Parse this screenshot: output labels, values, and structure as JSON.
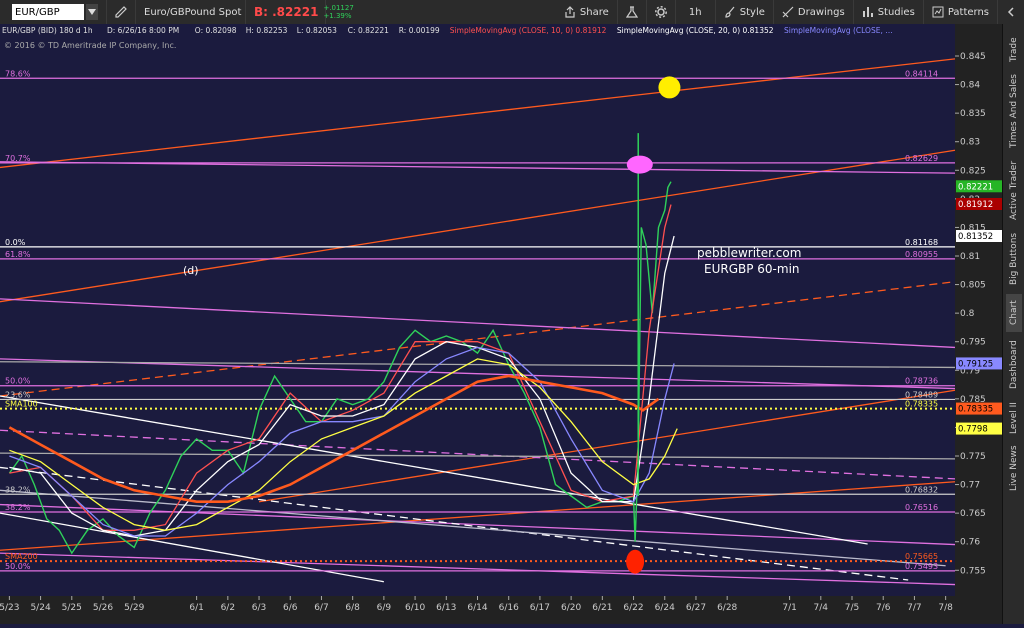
{
  "toolbar": {
    "symbol": "EUR/GBP",
    "pencil_icon": "pencil-icon",
    "description": "Euro/GBPound Spot",
    "bid_label": "B: .82221",
    "change_abs": "+.01127",
    "change_pct": "+1.39%",
    "share_label": "Share",
    "interval_label": "1h",
    "style_label": "Style",
    "drawings_label": "Drawings",
    "studies_label": "Studies",
    "patterns_label": "Patterns"
  },
  "chart_header": {
    "ohlc": [
      "EUR/GBP (BID) 180 d 1h",
      "D: 6/26/16 8:00 PM",
      "O: 0.82098",
      "H: 0.82253",
      "L: 0.82053",
      "C: 0.82221",
      "R: 0.00199"
    ],
    "studies": [
      {
        "text": "SimpleMovingAvg (CLOSE, 10, 0)",
        "value": "0.81912",
        "color": "#ff5050"
      },
      {
        "text": "SimpleMovingAvg (CLOSE, 20, 0)",
        "value": "0.81352",
        "color": "#ffffff"
      },
      {
        "text": "SimpleMovingAvg (CLOSE, …",
        "value": "",
        "color": "#8888ff"
      }
    ],
    "copyright": "© 2016 © TD Ameritrade IP Company, Inc."
  },
  "annotations": {
    "letter": "(d)",
    "site": "pebblewriter.com",
    "subtitle": "EURGBP 60-min"
  },
  "sidebar": [
    "Trade",
    "Times And Sales",
    "Active Trader",
    "Big Buttons",
    "Chart",
    "Dashboard",
    "Level II",
    "Live News"
  ],
  "chart_data": {
    "type": "line",
    "title": "EURGBP 60-min",
    "ylim": [
      0.7505,
      0.8485
    ],
    "yticks": [
      0.755,
      0.76,
      0.765,
      0.77,
      0.775,
      0.78,
      0.785,
      0.79,
      0.795,
      0.8,
      0.805,
      0.81,
      0.815,
      0.82,
      0.825,
      0.83,
      0.835,
      0.84,
      0.845
    ],
    "ytick_labels": [
      "0.755",
      "0.76",
      "0.765",
      "0.77",
      "0.775",
      "0.78",
      "0.785",
      "0.79",
      "0.795",
      "0.8",
      "0.805",
      "0.81",
      "0.815",
      "0.82",
      "0.825",
      "0.83",
      "0.835",
      "0.84",
      "0.845"
    ],
    "xticks": [
      {
        "label": "5/23",
        "x": 0
      },
      {
        "label": "5/24",
        "x": 1
      },
      {
        "label": "5/25",
        "x": 2
      },
      {
        "label": "5/26",
        "x": 3
      },
      {
        "label": "5/29",
        "x": 4
      },
      {
        "label": "6/1",
        "x": 6
      },
      {
        "label": "6/2",
        "x": 7
      },
      {
        "label": "6/3",
        "x": 8
      },
      {
        "label": "6/6",
        "x": 9
      },
      {
        "label": "6/7",
        "x": 10
      },
      {
        "label": "6/8",
        "x": 11
      },
      {
        "label": "6/9",
        "x": 12
      },
      {
        "label": "6/10",
        "x": 13
      },
      {
        "label": "6/13",
        "x": 14
      },
      {
        "label": "6/14",
        "x": 15
      },
      {
        "label": "6/16",
        "x": 16
      },
      {
        "label": "6/17",
        "x": 17
      },
      {
        "label": "6/20",
        "x": 18
      },
      {
        "label": "6/21",
        "x": 19
      },
      {
        "label": "6/22",
        "x": 20
      },
      {
        "label": "6/24",
        "x": 21
      },
      {
        "label": "6/27",
        "x": 22
      },
      {
        "label": "6/28",
        "x": 23
      },
      {
        "label": "7/1",
        "x": 25
      },
      {
        "label": "7/4",
        "x": 26
      },
      {
        "label": "7/5",
        "x": 27
      },
      {
        "label": "7/6",
        "x": 28
      },
      {
        "label": "7/7",
        "x": 29
      },
      {
        "label": "7/8",
        "x": 30
      }
    ],
    "xlim": [
      -0.3,
      30.3
    ],
    "series": [
      {
        "name": "Price",
        "color": "#2fd15a",
        "x": [
          0,
          0.4,
          0.8,
          1.2,
          1.6,
          2,
          2.5,
          3,
          3.5,
          4,
          4.5,
          5,
          5.5,
          6,
          6.5,
          7,
          7.5,
          8,
          8.5,
          9,
          9.5,
          10,
          10.5,
          11,
          11.5,
          12,
          12.5,
          13,
          13.5,
          14,
          14.5,
          15,
          15.5,
          16,
          16.5,
          17,
          17.5,
          18,
          18.5,
          19,
          19.5,
          20,
          20.05,
          20.15,
          20.25,
          20.4,
          20.6,
          20.8,
          21,
          21.1,
          21.2
        ],
        "values": [
          0.772,
          0.775,
          0.77,
          0.764,
          0.762,
          0.758,
          0.762,
          0.764,
          0.761,
          0.759,
          0.765,
          0.769,
          0.775,
          0.778,
          0.776,
          0.776,
          0.772,
          0.783,
          0.789,
          0.785,
          0.781,
          0.781,
          0.785,
          0.784,
          0.785,
          0.788,
          0.794,
          0.797,
          0.795,
          0.796,
          0.795,
          0.793,
          0.797,
          0.791,
          0.786,
          0.78,
          0.77,
          0.768,
          0.766,
          0.767,
          0.767,
          0.768,
          0.76,
          0.775,
          0.815,
          0.812,
          0.8,
          0.815,
          0.818,
          0.822,
          0.823
        ]
      },
      {
        "name": "SMA10",
        "color": "#ff5050",
        "x": [
          0,
          1,
          2,
          3,
          4,
          5,
          6,
          7,
          8,
          9,
          10,
          11,
          12,
          13,
          14,
          15,
          16,
          17,
          18,
          19,
          20,
          20.5,
          21,
          21.2
        ],
        "values": [
          0.772,
          0.773,
          0.768,
          0.762,
          0.762,
          0.763,
          0.772,
          0.776,
          0.778,
          0.786,
          0.781,
          0.783,
          0.786,
          0.795,
          0.795,
          0.795,
          0.793,
          0.781,
          0.769,
          0.767,
          0.768,
          0.797,
          0.815,
          0.819
        ]
      },
      {
        "name": "SMA20",
        "color": "#ffffff",
        "x": [
          0,
          1,
          2,
          3,
          4,
          5,
          6,
          7,
          8,
          9,
          10,
          11,
          12,
          13,
          14,
          15,
          16,
          17,
          18,
          19,
          20,
          20.5,
          21,
          21.3
        ],
        "values": [
          0.773,
          0.772,
          0.765,
          0.762,
          0.761,
          0.762,
          0.769,
          0.774,
          0.777,
          0.784,
          0.782,
          0.782,
          0.784,
          0.792,
          0.795,
          0.794,
          0.792,
          0.785,
          0.772,
          0.767,
          0.767,
          0.785,
          0.807,
          0.8135
        ]
      },
      {
        "name": "SMA50",
        "color": "#8888ff",
        "x": [
          0,
          1,
          2,
          3,
          4,
          5,
          6,
          7,
          8,
          9,
          10,
          11,
          12,
          13,
          14,
          15,
          16,
          17,
          18,
          19,
          20,
          20.5,
          21,
          21.3
        ],
        "values": [
          0.775,
          0.773,
          0.768,
          0.763,
          0.761,
          0.761,
          0.765,
          0.77,
          0.774,
          0.779,
          0.781,
          0.781,
          0.782,
          0.788,
          0.792,
          0.794,
          0.793,
          0.788,
          0.778,
          0.769,
          0.767,
          0.772,
          0.785,
          0.7912
        ]
      },
      {
        "name": "SMA100",
        "color": "#ffff44",
        "x": [
          0,
          1,
          2,
          3,
          4,
          5,
          6,
          7,
          8,
          9,
          10,
          11,
          12,
          13,
          14,
          15,
          16,
          17,
          18,
          19,
          20,
          20.5,
          21,
          21.4
        ],
        "values": [
          0.776,
          0.774,
          0.77,
          0.766,
          0.763,
          0.762,
          0.763,
          0.766,
          0.769,
          0.774,
          0.778,
          0.78,
          0.782,
          0.786,
          0.789,
          0.792,
          0.791,
          0.787,
          0.781,
          0.774,
          0.77,
          0.771,
          0.775,
          0.7798
        ]
      },
      {
        "name": "SMA200",
        "color": "#ff5a1e",
        "x": [
          0,
          1,
          2,
          3,
          4,
          5,
          6,
          7,
          8,
          9,
          10,
          11,
          12,
          13,
          14,
          15,
          16,
          17,
          18,
          19,
          20,
          20.3,
          20.8
        ],
        "values": [
          0.78,
          0.777,
          0.774,
          0.771,
          0.769,
          0.768,
          0.767,
          0.767,
          0.768,
          0.77,
          0.773,
          0.776,
          0.779,
          0.782,
          0.785,
          0.788,
          0.789,
          0.788,
          0.787,
          0.786,
          0.784,
          0.783,
          0.785
        ]
      }
    ],
    "levels": [
      {
        "label": "78.6%",
        "value": 0.8411,
        "value_label": "0.84114",
        "color": "#e070e0"
      },
      {
        "label": "70.7%",
        "value": 0.8263,
        "value_label": "0.82629",
        "color": "#e070e0"
      },
      {
        "label": "0.0%",
        "value": 0.8116,
        "value_label": "0.81168",
        "color": "#ffffff"
      },
      {
        "label": "61.8%",
        "value": 0.8095,
        "value_label": "0.80955",
        "color": "#e070e0"
      },
      {
        "label": "50.0%",
        "value": 0.7873,
        "value_label": "0.78736",
        "color": "#e070e0"
      },
      {
        "label": "23.6%",
        "value": 0.7849,
        "value_label": "0.78489",
        "color": "#cccccc"
      },
      {
        "label": "SMA100",
        "value": 0.7833,
        "value_label": "0.78335",
        "color": "#ffff44"
      },
      {
        "label": "38.2%",
        "value": 0.7683,
        "value_label": "0.76832",
        "color": "#cccccc"
      },
      {
        "label": "38.2%",
        "value": 0.7652,
        "value_label": "0.76516",
        "color": "#e070e0"
      },
      {
        "label": "SMA200",
        "value": 0.7566,
        "value_label": "0.75665",
        "color": "#ff5a1e"
      },
      {
        "label": "50.0%",
        "value": 0.7549,
        "value_label": "0.75493",
        "color": "#e070e0"
      }
    ],
    "price_tags": [
      {
        "value": 0.8222,
        "label": "0.82221",
        "bg": "#26b526",
        "fg": "#ffffff"
      },
      {
        "value": 0.8191,
        "label": "0.81912",
        "bg": "#aa0000",
        "fg": "#ffffff"
      },
      {
        "value": 0.8135,
        "label": "0.81352",
        "bg": "#ffffff",
        "fg": "#000000"
      },
      {
        "value": 0.7912,
        "label": "0.79125",
        "bg": "#8888ff",
        "fg": "#000000"
      },
      {
        "value": 0.7833,
        "label": "0.78335",
        "bg": "#ff5a1e",
        "fg": "#000000"
      },
      {
        "value": 0.7798,
        "label": "0.7798",
        "bg": "#ffff44",
        "fg": "#000000"
      }
    ],
    "trendlines": [
      {
        "x1": -0.3,
        "y1": 0.8255,
        "x2": 30.3,
        "y2": 0.8445,
        "color": "#ff5a1e",
        "dash": false
      },
      {
        "x1": -0.3,
        "y1": 0.802,
        "x2": 30.3,
        "y2": 0.8285,
        "color": "#ff5a1e",
        "dash": false
      },
      {
        "x1": -0.3,
        "y1": 0.7855,
        "x2": 30.3,
        "y2": 0.8055,
        "color": "#ff5a1e",
        "dash": true
      },
      {
        "x1": -0.3,
        "y1": 0.7585,
        "x2": 30.3,
        "y2": 0.7705,
        "color": "#ff5a1e",
        "dash": false
      },
      {
        "x1": 8,
        "y1": 0.767,
        "x2": 30.3,
        "y2": 0.7865,
        "color": "#ff5a1e",
        "dash": false
      },
      {
        "x1": -0.3,
        "y1": 0.8025,
        "x2": 30.3,
        "y2": 0.794,
        "color": "#e070e0",
        "dash": false
      },
      {
        "x1": -0.3,
        "y1": 0.8265,
        "x2": 30.3,
        "y2": 0.8245,
        "color": "#e070e0",
        "dash": false
      },
      {
        "x1": -0.3,
        "y1": 0.792,
        "x2": 30.3,
        "y2": 0.7868,
        "color": "#e070e0",
        "dash": false
      },
      {
        "x1": -0.3,
        "y1": 0.7795,
        "x2": 30.3,
        "y2": 0.771,
        "color": "#e070e0",
        "dash": true
      },
      {
        "x1": -0.3,
        "y1": 0.7665,
        "x2": 30.3,
        "y2": 0.7595,
        "color": "#e070e0",
        "dash": false
      },
      {
        "x1": -0.3,
        "y1": 0.758,
        "x2": 30.3,
        "y2": 0.7525,
        "color": "#e070e0",
        "dash": false
      },
      {
        "x1": -0.3,
        "y1": 0.7855,
        "x2": 27.5,
        "y2": 0.7596,
        "color": "#ffffff",
        "dash": false
      },
      {
        "x1": -0.3,
        "y1": 0.773,
        "x2": 28.8,
        "y2": 0.7533,
        "color": "#ffffff",
        "dash": true
      },
      {
        "x1": -0.3,
        "y1": 0.769,
        "x2": 30,
        "y2": 0.7558,
        "color": "#bbbbcc",
        "dash": false
      },
      {
        "x1": -0.3,
        "y1": 0.765,
        "x2": 12,
        "y2": 0.753,
        "color": "#ffffff",
        "dash": false
      },
      {
        "x1": -0.3,
        "y1": 0.7755,
        "x2": 30.3,
        "y2": 0.7745,
        "color": "#aaaaaa",
        "dash": false
      },
      {
        "x1": -0.3,
        "y1": 0.7915,
        "x2": 30.3,
        "y2": 0.7905,
        "color": "#aaaaaa",
        "dash": false
      }
    ],
    "markers": [
      {
        "x": 21.15,
        "y": 0.8395,
        "color": "#ffee00",
        "rx": 11,
        "ry": 11
      },
      {
        "x": 20.2,
        "y": 0.826,
        "color": "#ff66ff",
        "rx": 13,
        "ry": 9
      },
      {
        "x": 20.05,
        "y": 0.7565,
        "color": "#ff2200",
        "rx": 9,
        "ry": 12
      }
    ],
    "grid": false,
    "legend": "top-left"
  }
}
